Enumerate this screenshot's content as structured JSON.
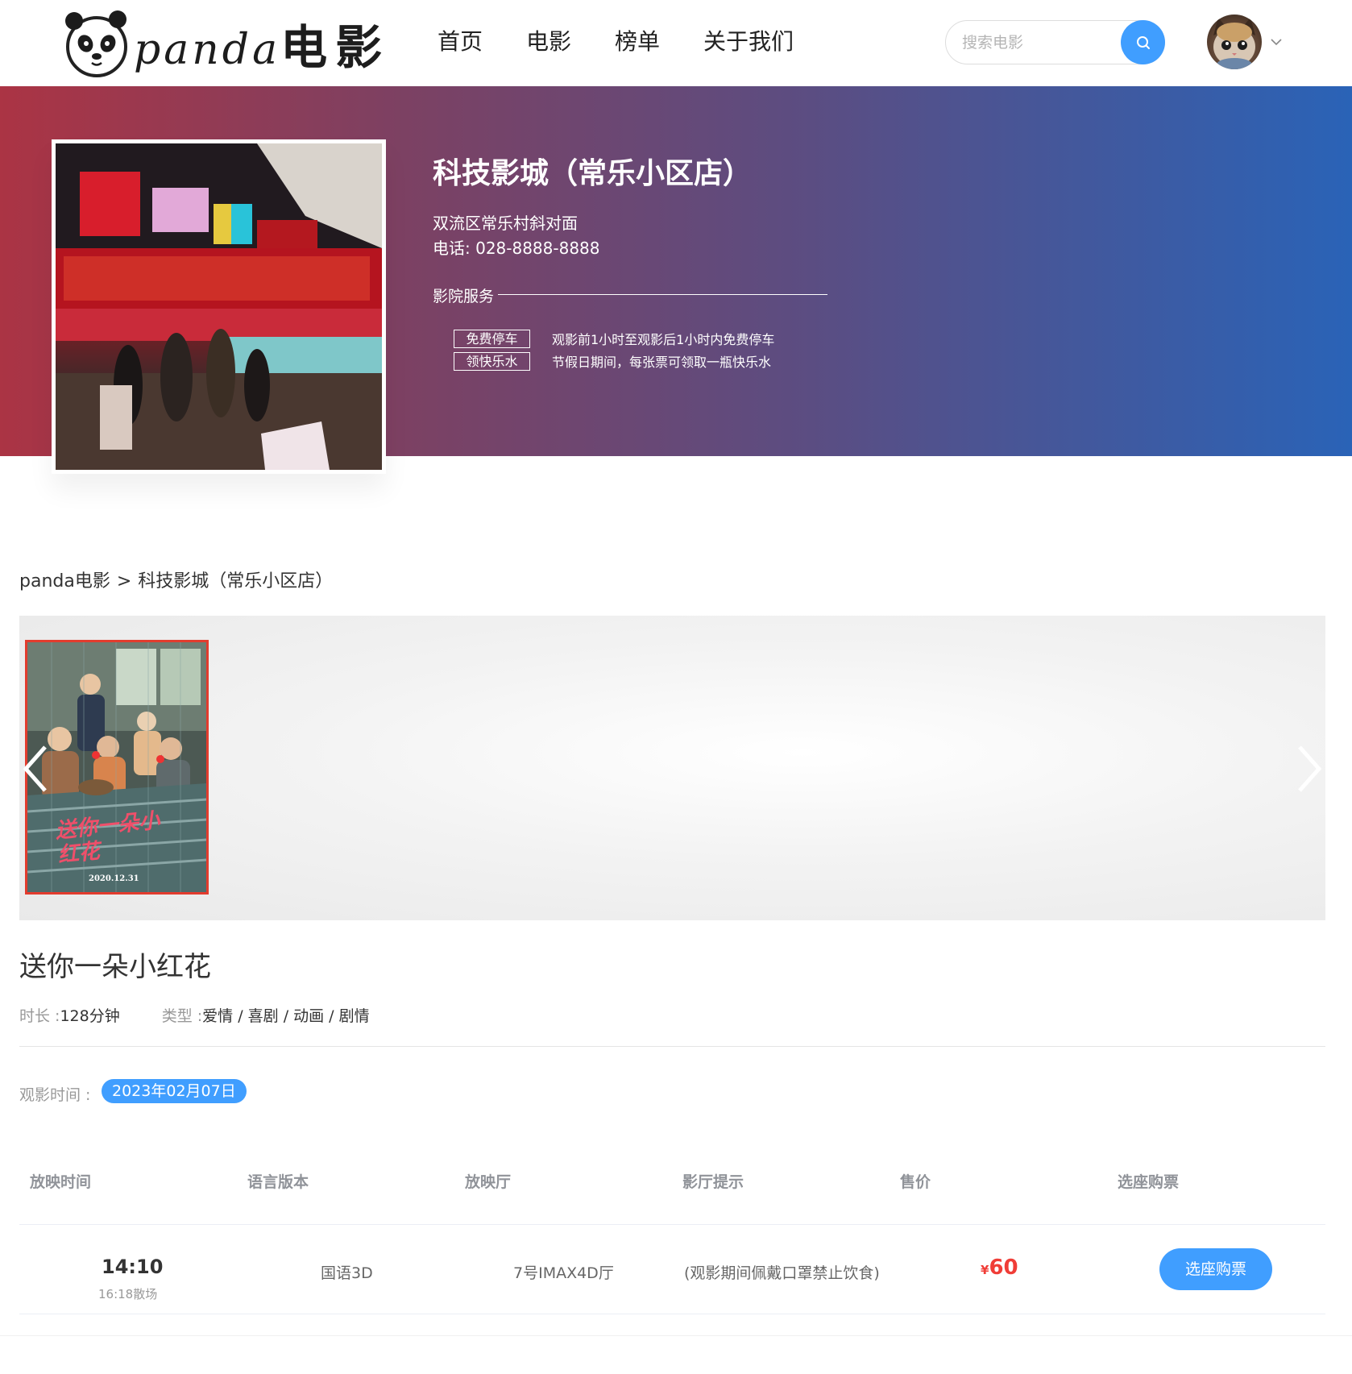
{
  "header": {
    "logo_latin": "panda",
    "logo_cn": "电影",
    "nav": [
      "首页",
      "电影",
      "榜单",
      "关于我们"
    ],
    "search_placeholder": "搜索电影"
  },
  "cinema": {
    "name": "科技影城（常乐小区店）",
    "address": "双流区常乐村斜对面",
    "phone": "电话: 028-8888-8888",
    "service_title": "影院服务",
    "services": [
      {
        "tag": "免费停车",
        "desc": "观影前1小时至观影后1小时内免费停车"
      },
      {
        "tag": "领快乐水",
        "desc": "节假日期间，每张票可领取一瓶快乐水"
      }
    ]
  },
  "breadcrumb": {
    "home": "panda电影",
    "separator": ">",
    "current": "科技影城（常乐小区店）"
  },
  "poster": {
    "title_art": "送你一朵小红花",
    "date": "2020.12.31"
  },
  "movie": {
    "title": "送你一朵小红花",
    "duration_label": "时长 : ",
    "duration": "128分钟",
    "genre_label": "类型 : ",
    "genres": "爱情 / 喜剧 / 动画 / 剧情"
  },
  "watch": {
    "label": "观影时间 :",
    "date": "2023年02月07日"
  },
  "table": {
    "headers": [
      "放映时间",
      "语言版本",
      "放映厅",
      "影厅提示",
      "售价",
      "选座购票"
    ],
    "rows": [
      {
        "time": "14:10",
        "end": "16:18散场",
        "lang": "国语3D",
        "hall": "7号IMAX4D厅",
        "tip": "(观影期间佩戴口罩禁止饮食)",
        "currency": "¥",
        "price": "60",
        "button": "选座购票"
      }
    ]
  },
  "colors": {
    "accent": "#409eff",
    "price": "#f03d37",
    "banner_start": "#ab3444",
    "banner_end": "#2a63b7",
    "poster_border": "#e23c2e"
  }
}
